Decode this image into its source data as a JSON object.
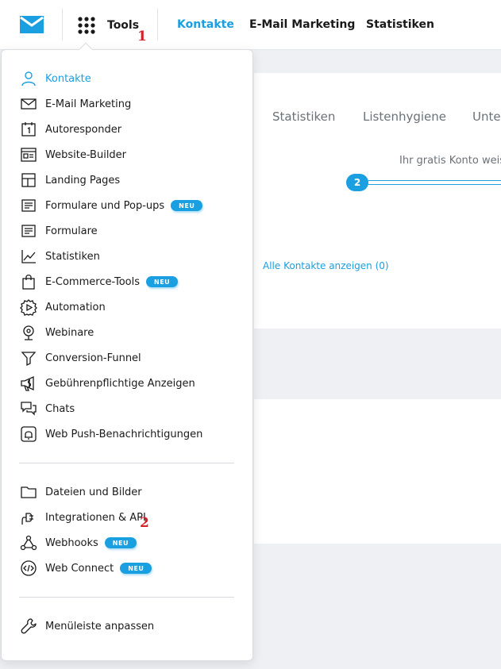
{
  "header": {
    "tools_label": "Tools",
    "nav": [
      "Kontakte",
      "E-Mail Marketing",
      "Statistiken"
    ]
  },
  "markers": [
    "1",
    "2"
  ],
  "background": {
    "tabs": [
      "Statistiken",
      "Listenhygiene",
      "Unter"
    ],
    "notice": "Ihr gratis Konto weis",
    "step_number": "2",
    "contacts_link": "Alle Kontakte anzeigen (0)"
  },
  "menu": {
    "badge_label": "NEU",
    "items": [
      {
        "label": "Kontakte",
        "icon": "person-icon",
        "active": true
      },
      {
        "label": "E-Mail Marketing",
        "icon": "envelope-icon"
      },
      {
        "label": "Autoresponder",
        "icon": "calendar-icon"
      },
      {
        "label": "Website-Builder",
        "icon": "website-icon"
      },
      {
        "label": "Landing Pages",
        "icon": "layout-icon"
      },
      {
        "label": "Formulare und Pop-ups",
        "icon": "form-icon",
        "badge": true
      },
      {
        "label": "Formulare",
        "icon": "form-icon"
      },
      {
        "label": "Statistiken",
        "icon": "chart-icon"
      },
      {
        "label": "E-Commerce-Tools",
        "icon": "shopping-bag-icon",
        "badge": true
      },
      {
        "label": "Automation",
        "icon": "gear-play-icon"
      },
      {
        "label": "Webinare",
        "icon": "webcam-icon"
      },
      {
        "label": "Conversion-Funnel",
        "icon": "funnel-icon"
      },
      {
        "label": "Gebührenpflichtige Anzeigen",
        "icon": "megaphone-icon"
      },
      {
        "label": "Chats",
        "icon": "chat-icon"
      },
      {
        "label": "Web Push-Benachrichtigungen",
        "icon": "bell-icon"
      }
    ],
    "items2": [
      {
        "label": "Dateien und Bilder",
        "icon": "folder-icon"
      },
      {
        "label": "Integrationen & API",
        "icon": "plug-icon"
      },
      {
        "label": "Webhooks",
        "icon": "webhook-icon",
        "badge": true
      },
      {
        "label": "Web Connect",
        "icon": "code-icon",
        "badge": true
      }
    ],
    "footer_item": {
      "label": "Menüleiste anpassen",
      "icon": "wrench-icon"
    }
  },
  "colors": {
    "accent": "#1a9fe0",
    "marker": "#d61f26",
    "text": "#1a1a1a"
  }
}
